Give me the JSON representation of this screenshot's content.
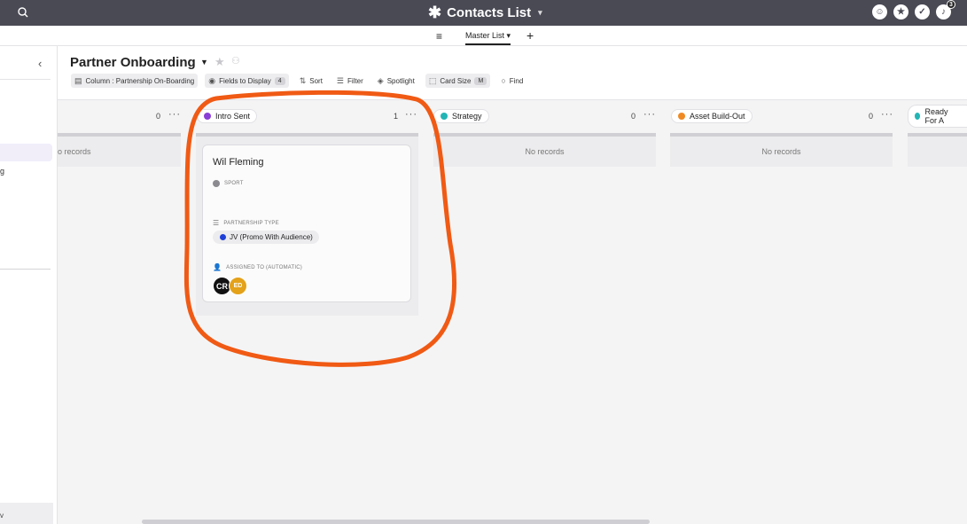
{
  "app": {
    "title": "Contacts List",
    "notifications_count": "3"
  },
  "subnav": {
    "view_label": "Master List"
  },
  "sidebar": {
    "item_fragment": "g",
    "bottom_fragment": "v"
  },
  "page": {
    "title": "Partner Onboarding"
  },
  "toolbar": {
    "column_label": "Column : Partnership On-Boarding",
    "fields_label": "Fields to Display",
    "fields_count": "4",
    "sort_label": "Sort",
    "filter_label": "Filter",
    "spotlight_label": "Spotlight",
    "card_size_label": "Card Size",
    "card_size_value": "M",
    "find_label": "Find"
  },
  "columns": [
    {
      "label": "",
      "count": "0",
      "norecords": "o records"
    },
    {
      "label": "Intro Sent",
      "count": "1",
      "color": "#8a3fd6"
    },
    {
      "label": "Strategy",
      "count": "0",
      "color": "#23b5b5",
      "norecords": "No records"
    },
    {
      "label": "Asset Build-Out",
      "count": "0",
      "color": "#f08a24",
      "norecords": "No records"
    },
    {
      "label": "Ready For A",
      "color": "#23b5b5"
    }
  ],
  "card": {
    "name": "Wil Fleming",
    "fields": [
      {
        "label": "SPORT",
        "value": ""
      },
      {
        "label": "PARTNERSHIP TYPE",
        "value": "JV (Promo With Audience)"
      },
      {
        "label": "ASSIGNED TO (AUTOMATIC)",
        "avatars": [
          "CR",
          "ED"
        ]
      }
    ]
  },
  "colors": {
    "accent": "#4a4a55",
    "annotation": "#f05a14"
  }
}
